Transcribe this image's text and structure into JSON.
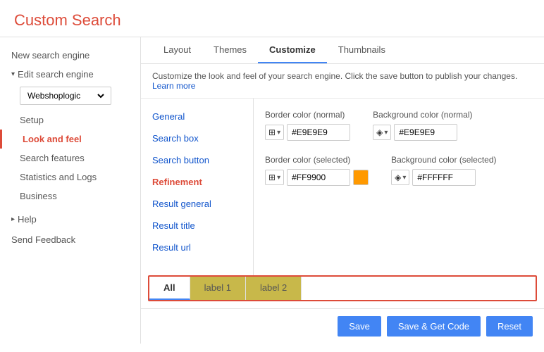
{
  "header": {
    "title": "Custom Search"
  },
  "sidebar": {
    "new_search_engine": "New search engine",
    "edit_search_engine": "Edit search engine",
    "engine_name": "Webshoplogic",
    "setup": "Setup",
    "look_and_feel": "Look and feel",
    "search_features": "Search features",
    "statistics_and_logs": "Statistics and Logs",
    "business": "Business",
    "help": "Help",
    "send_feedback": "Send Feedback"
  },
  "tabs": {
    "layout": "Layout",
    "themes": "Themes",
    "customize": "Customize",
    "thumbnails": "Thumbnails"
  },
  "description": {
    "text": "Customize the look and feel of your search engine. Click the save button to publish your changes.",
    "learn_more": "Learn more"
  },
  "left_nav": {
    "general": "General",
    "search_box": "Search box",
    "search_button": "Search button",
    "refinement": "Refinement",
    "result_general": "Result general",
    "result_title": "Result title",
    "result_url": "Result url"
  },
  "color_fields": {
    "border_normal_label": "Border color (normal)",
    "border_normal_value": "#E9E9E9",
    "bg_normal_label": "Background color (normal)",
    "bg_normal_value": "#E9E9E9",
    "border_selected_label": "Border color (selected)",
    "border_selected_value": "#FF9900",
    "bg_selected_label": "Background color (selected)",
    "bg_selected_value": "#FFFFFF"
  },
  "label_tabs": {
    "all": "All",
    "label1": "label 1",
    "label2": "label 2"
  },
  "footer": {
    "save": "Save",
    "save_get_code": "Save & Get Code",
    "reset": "Reset"
  },
  "colors": {
    "orange_swatch": "#FF9900",
    "accent": "#dd4b39",
    "blue": "#4285f4"
  }
}
